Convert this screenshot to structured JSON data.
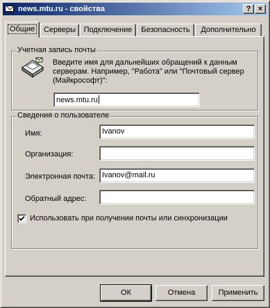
{
  "window": {
    "title": "news.mtu.ru - свойства",
    "help_label": "?",
    "close_label": "×"
  },
  "tabs": [
    {
      "label": "Общие"
    },
    {
      "label": "Серверы"
    },
    {
      "label": "Подключение"
    },
    {
      "label": "Безопасность"
    },
    {
      "label": "Дополнительно"
    }
  ],
  "account": {
    "group_title": "Учетная запись почты",
    "description": "Введите имя для дальнейших обращений к данным серверам. Например, \"Работа\" или \"Почтовый сервер (Майкрософт)\":",
    "name_value": "news.mtu.ru"
  },
  "user_info": {
    "group_title": "Сведения о пользователе",
    "name_label": "Имя:",
    "name_value": "Ivanov",
    "org_label": "Организация:",
    "org_value": "",
    "email_label": "Электронная почта:",
    "email_value": "Ivanov@mail.ru",
    "reply_label": "Обратный адрес:",
    "reply_value": ""
  },
  "sync_checkbox": {
    "label": "Использовать при получении почты или синхронизации",
    "checked": true
  },
  "buttons": {
    "ok": "ОК",
    "cancel": "Отмена",
    "apply": "Применить"
  },
  "colors": {
    "title_start": "#0a246a",
    "title_end": "#a6caf0",
    "face": "#d4d0c8"
  }
}
